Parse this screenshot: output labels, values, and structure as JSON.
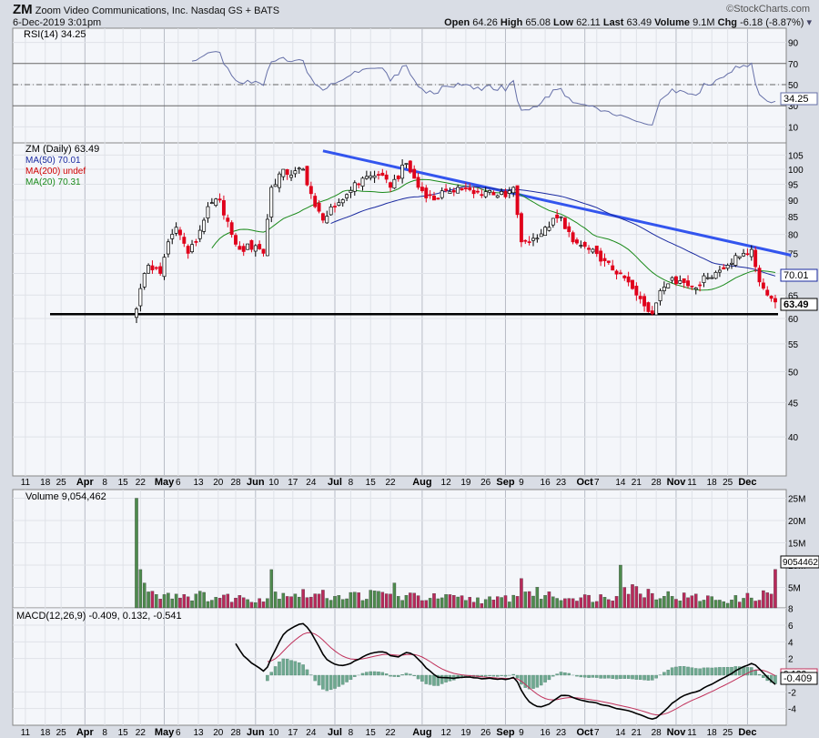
{
  "header": {
    "symbol": "ZM",
    "company": "Zoom Video Communications, Inc.",
    "exchange": "Nasdaq GS + BATS",
    "datetime": "6-Dec-2019 3:01pm",
    "brand": "©StockCharts.com",
    "open_label": "Open",
    "open": "64.26",
    "high_label": "High",
    "high": "65.08",
    "low_label": "Low",
    "low": "62.11",
    "last_label": "Last",
    "last": "63.49",
    "volume_label": "Volume",
    "volume": "9.1M",
    "chg_label": "Chg",
    "chg": "-6.18 (-8.87%)"
  },
  "colors": {
    "up": "#000000",
    "down": "#e0001b",
    "ma50": "#1a2aa0",
    "ma200": "#d00000",
    "ma20": "#1a8a1a",
    "trendline": "#3355ee",
    "rsi": "#6670a8",
    "volUp": "#4d8a4d",
    "volDown": "#b8295a",
    "macd": "#000000",
    "signal": "#c0305a",
    "hist": "#6fa890"
  },
  "rsi_panel": {
    "legend": "RSI(14) 34.25",
    "current": "34.25",
    "ticks": [
      "90",
      "70",
      "50",
      "30",
      "10"
    ],
    "tick_values": [
      90,
      70,
      50,
      30,
      10
    ]
  },
  "price_panel": {
    "legend_symbol": "ZM (Daily) 63.49",
    "legend_ma50": "MA(50) 70.01",
    "legend_ma200": "MA(200) undef",
    "legend_ma20": "MA(20) 70.31",
    "ma_label": "70.01",
    "last_label": "63.49",
    "ticks": [
      "105",
      "100",
      "95",
      "90",
      "85",
      "80",
      "75",
      "70",
      "65",
      "60",
      "55",
      "50",
      "45",
      "40"
    ],
    "tick_values": [
      105,
      100,
      95,
      90,
      85,
      80,
      75,
      70,
      65,
      60,
      55,
      50,
      45,
      40
    ]
  },
  "volume_panel": {
    "legend": "Volume 9,054,462",
    "current": "9054462",
    "ticks": [
      "25M",
      "20M",
      "15M",
      "10M",
      "5M"
    ],
    "tick_values": [
      25,
      20,
      15,
      10,
      5
    ]
  },
  "macd_panel": {
    "legend": "MACD(12,26,9) -0.409, 0.132, -0.541",
    "macd_current": "-0.409",
    "signal_current": "0.132",
    "ticks": [
      "8",
      "6",
      "4",
      "2",
      "-2",
      "-4"
    ],
    "tick_values": [
      8,
      6,
      4,
      2,
      -2,
      -4
    ]
  },
  "x_axis": {
    "ticks": [
      {
        "label": "11",
        "day": -28,
        "month": false
      },
      {
        "label": "18",
        "day": -23,
        "month": false
      },
      {
        "label": "25",
        "day": -19,
        "month": false
      },
      {
        "label": "Apr",
        "day": -13,
        "month": true
      },
      {
        "label": "8",
        "day": -8,
        "month": false
      },
      {
        "label": "15",
        "day": -3.4,
        "month": false
      },
      {
        "label": "22",
        "day": 1,
        "month": false
      },
      {
        "label": "May",
        "day": 7,
        "month": true
      },
      {
        "label": "6",
        "day": 10.5,
        "month": false
      },
      {
        "label": "13",
        "day": 15.6,
        "month": false
      },
      {
        "label": "20",
        "day": 20.6,
        "month": false
      },
      {
        "label": "28",
        "day": 25,
        "month": false
      },
      {
        "label": "Jun",
        "day": 30,
        "month": true
      },
      {
        "label": "10",
        "day": 34.6,
        "month": false
      },
      {
        "label": "17",
        "day": 39.4,
        "month": false
      },
      {
        "label": "24",
        "day": 44,
        "month": false
      },
      {
        "label": "Jul",
        "day": 50,
        "month": true
      },
      {
        "label": "8",
        "day": 54,
        "month": false
      },
      {
        "label": "15",
        "day": 59,
        "month": false
      },
      {
        "label": "22",
        "day": 64,
        "month": false
      },
      {
        "label": "Aug",
        "day": 72,
        "month": true
      },
      {
        "label": "12",
        "day": 78,
        "month": false
      },
      {
        "label": "19",
        "day": 83,
        "month": false
      },
      {
        "label": "26",
        "day": 88,
        "month": false
      },
      {
        "label": "Sep",
        "day": 93,
        "month": true
      },
      {
        "label": "9",
        "day": 97,
        "month": false
      },
      {
        "label": "16",
        "day": 103,
        "month": false
      },
      {
        "label": "23",
        "day": 107,
        "month": false
      },
      {
        "label": "Oct",
        "day": 113,
        "month": true
      },
      {
        "label": "7",
        "day": 116,
        "month": false
      },
      {
        "label": "14",
        "day": 122,
        "month": false
      },
      {
        "label": "21",
        "day": 126,
        "month": false
      },
      {
        "label": "28",
        "day": 131,
        "month": false
      },
      {
        "label": "Nov",
        "day": 136,
        "month": true
      },
      {
        "label": "11",
        "day": 140,
        "month": false
      },
      {
        "label": "18",
        "day": 145,
        "month": false
      },
      {
        "label": "25",
        "day": 149,
        "month": false
      },
      {
        "label": "Dec",
        "day": 154,
        "month": true
      }
    ]
  },
  "chart_data": {
    "type": "line",
    "title": "ZM Zoom Video Communications, Inc. Daily (candlestick)",
    "scale": "log",
    "ylim": [
      37,
      110
    ],
    "days": 162,
    "close_anchors": [
      [
        0,
        62
      ],
      [
        2,
        70
      ],
      [
        3,
        72
      ],
      [
        6,
        70
      ],
      [
        8,
        78
      ],
      [
        10,
        82
      ],
      [
        13,
        75
      ],
      [
        15,
        78
      ],
      [
        18,
        88
      ],
      [
        21,
        90
      ],
      [
        24,
        80
      ],
      [
        26,
        76
      ],
      [
        30,
        77
      ],
      [
        32,
        75
      ],
      [
        34,
        94
      ],
      [
        37,
        100
      ],
      [
        39,
        98
      ],
      [
        42,
        100
      ],
      [
        45,
        88
      ],
      [
        47,
        84
      ],
      [
        50,
        88
      ],
      [
        54,
        93
      ],
      [
        57,
        97
      ],
      [
        61,
        98
      ],
      [
        64,
        94
      ],
      [
        68,
        102
      ],
      [
        71,
        94
      ],
      [
        75,
        90
      ],
      [
        78,
        93
      ],
      [
        81,
        94
      ],
      [
        85,
        92
      ],
      [
        89,
        93
      ],
      [
        93,
        91
      ],
      [
        95,
        94
      ],
      [
        97,
        78
      ],
      [
        101,
        79
      ],
      [
        103,
        82
      ],
      [
        107,
        85
      ],
      [
        110,
        78
      ],
      [
        114,
        76
      ],
      [
        117,
        73
      ],
      [
        122,
        70
      ],
      [
        126,
        65
      ],
      [
        130,
        61
      ],
      [
        132,
        66
      ],
      [
        135,
        69
      ],
      [
        140,
        67
      ],
      [
        144,
        69
      ],
      [
        149,
        72
      ],
      [
        153,
        75
      ],
      [
        155,
        76
      ],
      [
        157,
        68
      ],
      [
        159,
        65
      ],
      [
        161,
        63.49
      ]
    ],
    "volume_anchors_millions": [
      [
        0,
        25
      ],
      [
        1,
        9
      ],
      [
        2,
        6
      ],
      [
        3,
        4
      ],
      [
        10,
        3.5
      ],
      [
        20,
        2.8
      ],
      [
        33,
        2.5
      ],
      [
        34,
        9
      ],
      [
        35,
        4
      ],
      [
        50,
        3
      ],
      [
        64,
        3.5
      ],
      [
        65,
        6
      ],
      [
        66,
        3
      ],
      [
        90,
        2.2
      ],
      [
        96,
        3
      ],
      [
        97,
        7
      ],
      [
        98,
        4
      ],
      [
        110,
        2.5
      ],
      [
        121,
        3
      ],
      [
        122,
        10
      ],
      [
        123,
        5
      ],
      [
        135,
        3
      ],
      [
        150,
        2.2
      ],
      [
        160,
        3.5
      ],
      [
        161,
        9.05
      ]
    ],
    "trendline": [
      [
        47,
        106.5
      ],
      [
        165,
        74.5
      ]
    ],
    "support_level": 60.9,
    "indicators": {
      "ma50": 70.01,
      "ma20": 70.31,
      "rsi14": 34.25,
      "macd": -0.409,
      "signal": 0.132,
      "histogram": -0.541
    }
  }
}
